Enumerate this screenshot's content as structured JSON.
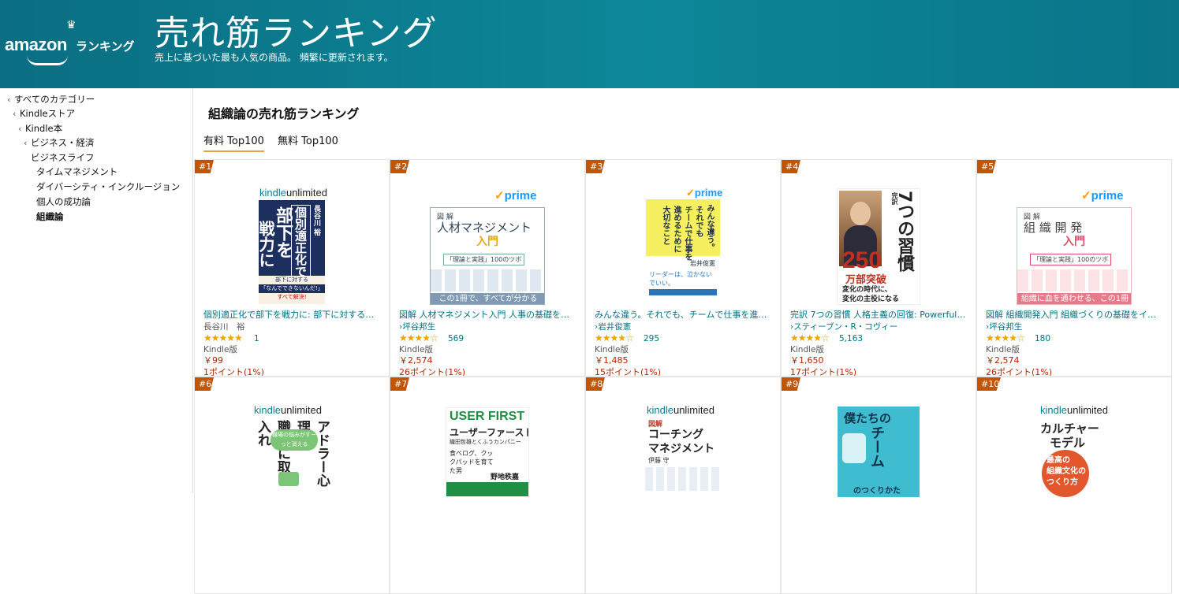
{
  "header": {
    "logo_text": "amazon",
    "logo_ranking": "ランキング",
    "title": "売れ筋ランキング",
    "subtitle": "売上に基づいた最も人気の商品。 頻繁に更新されます。"
  },
  "sidebar": {
    "items": [
      {
        "label": "すべてのカテゴリー"
      },
      {
        "label": "Kindleストア"
      },
      {
        "label": "Kindle本"
      },
      {
        "label": "ビジネス・経済"
      },
      {
        "label": "ビジネスライフ"
      },
      {
        "label": "タイムマネジメント"
      },
      {
        "label": "ダイバーシティ・インクルージョン"
      },
      {
        "label": "個人の成功論"
      },
      {
        "label": "組織論"
      }
    ]
  },
  "main": {
    "title": "組織論の売れ筋ランキング",
    "tabs": [
      {
        "label": "有料 Top100",
        "active": true
      },
      {
        "label": "無料 Top100",
        "active": false
      }
    ]
  },
  "badges": {
    "kindle": "kindle",
    "unlimited": "unlimited",
    "prime_check": "✓",
    "prime": "prime"
  },
  "books": [
    {
      "rank": "#1",
      "title": "個別適正化で部下を戦力に: 部下に対する「…",
      "author": "長谷川　裕",
      "rating": 5.0,
      "stars": "★★★★★",
      "reviews": "1",
      "format": "Kindle版",
      "price": "￥99",
      "points": "1ポイント(1%)",
      "badge": "ku",
      "cover": {
        "line1": "個別適正化で",
        "line2": "部下を",
        "line3": "戦力に",
        "author": "長谷川 裕",
        "note1": "部下に対する",
        "note2": "「なんでできないんだ!」",
        "note3": "すべて解決!"
      }
    },
    {
      "rank": "#2",
      "title": "図解 人材マネジメント入門 人事の基礎をゼ…",
      "author": "坪谷邦生",
      "rating": 4.5,
      "stars": "★★★★☆",
      "reviews": "569",
      "format": "Kindle版",
      "price": "￥2,574",
      "points": "26ポイント(1%)",
      "badge": "prime",
      "cover": {
        "small": "図 解",
        "main": "人材マネジメント",
        "nyumon": "入門",
        "tag": "「理論と実践」100のツボ",
        "foot": "この1冊で、すべてが分かる"
      }
    },
    {
      "rank": "#3",
      "title": "みんな違う。それでも、チームで仕事を進め…",
      "author": "岩井俊憲",
      "rating": 4.5,
      "stars": "★★★★☆",
      "reviews": "295",
      "format": "Kindle版",
      "price": "￥1,485",
      "points": "15ポイント(1%)",
      "badge": "prime",
      "cover": {
        "v1": "みんな違う。",
        "v2": "それでも",
        "v3": "チームで仕事を",
        "v4": "進めるために",
        "v5": "大切なこと",
        "author": "岩井俊憲",
        "lower": "リーダーは、泣かないでいい。"
      }
    },
    {
      "rank": "#4",
      "title": "完訳 7つの習慣 人格主義の回復: Powerful…",
      "author": "スティーブン・R・コヴィー",
      "rating": 4.5,
      "stars": "★★★★☆",
      "reviews": "5,163",
      "format": "Kindle版",
      "price": "￥1,650",
      "points": "17ポイント(1%)",
      "badge": "none",
      "cover": {
        "kanyaku": "完訳",
        "main": "7つの習慣",
        "num": "250",
        "unit": "万部突破",
        "line1": "変化の時代に、",
        "line2": "変化の主役になる"
      }
    },
    {
      "rank": "#5",
      "title": "図解 組織開発入門 組織づくりの基礎をイチ…",
      "author": "坪谷邦生",
      "rating": 4.0,
      "stars": "★★★★☆",
      "reviews": "180",
      "format": "Kindle版",
      "price": "￥2,574",
      "points": "26ポイント(1%)",
      "badge": "prime",
      "cover": {
        "small": "図 解",
        "main": "組 織 開 発",
        "nyumon": "入門",
        "tag": "「理論と実践」100のツボ",
        "foot": "組織に血を通わせる、この1冊"
      }
    },
    {
      "rank": "#6",
      "badge": "ku",
      "cover": {
        "v1": "職場に取り入れ",
        "v2": "アドラー心理",
        "bubble": "職場の悩みがすーっと消える"
      }
    },
    {
      "rank": "#7",
      "badge": "none",
      "cover": {
        "top": "USER FIRST",
        "main": "ユーザーファースト",
        "sub": "織田哲雄とくふうカンパニー",
        "mid": "食べログ、クックパッドを育てた男",
        "author": "野地秩嘉"
      }
    },
    {
      "rank": "#8",
      "badge": "ku",
      "cover": {
        "small": "図解",
        "main1": "コーチング",
        "main2": "マネジメント",
        "author": "伊藤 守"
      }
    },
    {
      "rank": "#9",
      "badge": "none",
      "cover": {
        "main1": "僕たちの",
        "main2": "チーム",
        "main3": "のつくりかた"
      }
    },
    {
      "rank": "#10",
      "badge": "ku",
      "cover": {
        "main1": "カルチャー",
        "main2": "モデル",
        "sub1": "最高の",
        "sub2": "組織文化の",
        "sub3": "つくり方"
      }
    }
  ]
}
